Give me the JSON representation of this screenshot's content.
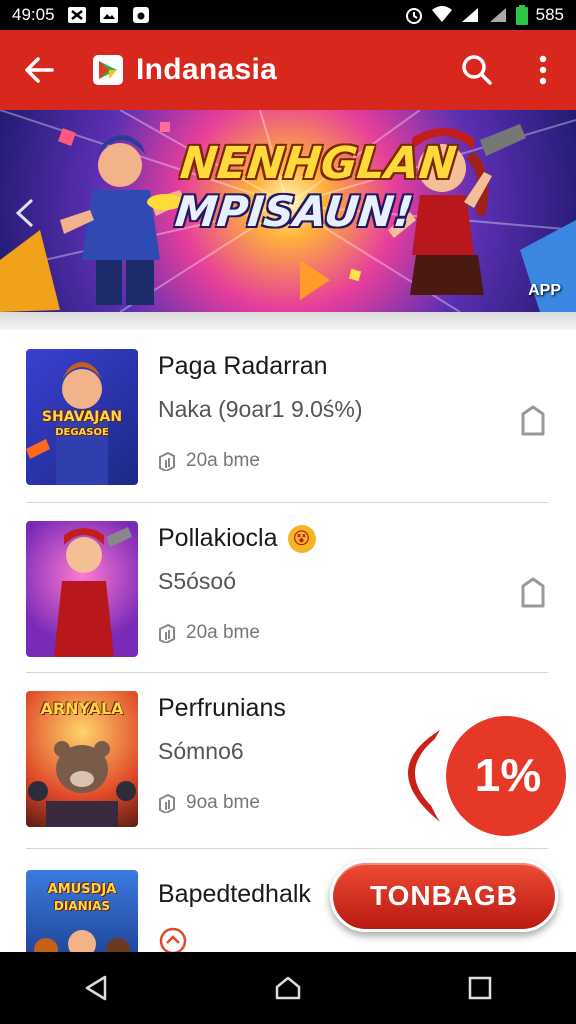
{
  "status_bar": {
    "time": "49:05",
    "battery": "585",
    "icons": [
      "notification-icon",
      "image-icon",
      "camera-icon",
      "alarm-icon",
      "wifi-icon",
      "signal-icon",
      "battery-icon"
    ]
  },
  "app_bar": {
    "title": "Indanasia",
    "icons": [
      "back-arrow-icon",
      "app-logo",
      "search-icon",
      "more-vert-icon"
    ]
  },
  "banner": {
    "title_line1": "NENHGLAN",
    "title_line2": "MPISAUN!",
    "badge": "APP"
  },
  "list": {
    "items": [
      {
        "title": "Paga Radarran",
        "subtitle": "Naka  (9oar1 9.0ś%)",
        "meta": "20a bme",
        "thumb_text": "SHAVAJAN",
        "thumb_subtext": "DEGASOE"
      },
      {
        "title": "Pollakiocla",
        "subtitle": "S5ósoó",
        "meta": "20a bme",
        "title_emoji": "😵"
      },
      {
        "title": "Perfrunians",
        "subtitle": "Sómno6",
        "meta": "9oa bme",
        "thumb_text": "ARNYALA"
      },
      {
        "title": "Bapedtedhalk",
        "thumb_text": "AMUSDJA",
        "thumb_subtext": "DIANIAS"
      }
    ]
  },
  "cta": {
    "label": "TONBAGB"
  },
  "promo": {
    "label": "1%"
  },
  "colors": {
    "primary": "#d8281e",
    "accent": "#ffd83a"
  }
}
